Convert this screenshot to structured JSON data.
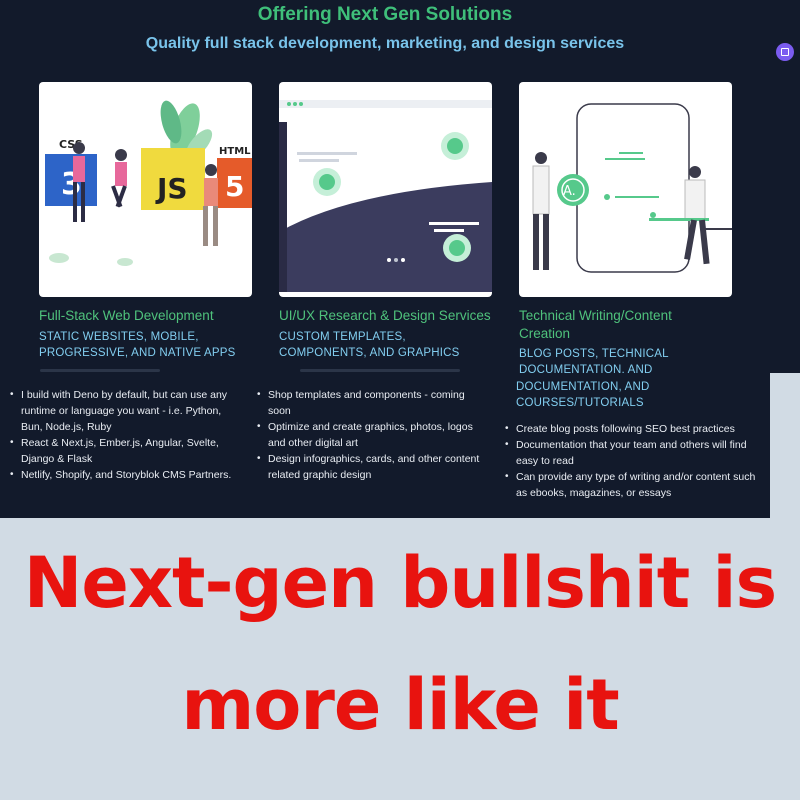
{
  "header": {
    "title": "Offering Next Gen Solutions",
    "subtitle": "Quality full stack development, marketing, and design services"
  },
  "cards": [
    {
      "illustration": {
        "css": "CSS",
        "js": "JS",
        "html": "HTML",
        "css_num": "3",
        "html_num": "5"
      },
      "title": "Full-Stack Web Development",
      "tags": "STATIC WEBSITES, MOBILE, PROGRESSIVE, AND NATIVE APPS",
      "bullets": [
        "I build with Deno by default, but can use any runtime or language you want - i.e. Python, Bun, Node.js, Ruby",
        "React & Next.js, Ember.js, Angular, Svelte, Django & Flask",
        "Netlify, Shopify, and Storyblok CMS Partners."
      ]
    },
    {
      "title": "UI/UX Research & Design Services",
      "tags": "CUSTOM TEMPLATES, COMPONENTS, AND GRAPHICS",
      "bullets": [
        "Shop templates and components - coming soon",
        "Optimize and create graphics, photos, logos and other digital art",
        "Design infographics, cards, and other content related graphic design"
      ]
    },
    {
      "illustration": {
        "badge": "A."
      },
      "title": "Technical Writing/Content Creation",
      "tags_upper": "BLOG POSTS, TECHNICAL DOCUMENTATION, AND",
      "tags_lower": "DOCUMENTATION, AND COURSES/TUTORIALS",
      "bullets": [
        "Create blog posts following SEO best practices",
        "Documentation that your team and others will find easy to read",
        "Can provide any type of writing and/or content such as ebooks, magazines, or essays"
      ]
    }
  ],
  "caption": {
    "line1": "Next-gen bullshit is",
    "line2": "more like it"
  },
  "colors": {
    "background": "#121a2b",
    "accent_green": "#4fc27c",
    "accent_blue": "#82cef0",
    "caption_red": "#e8130f",
    "page_bg": "#d1dbe4"
  }
}
